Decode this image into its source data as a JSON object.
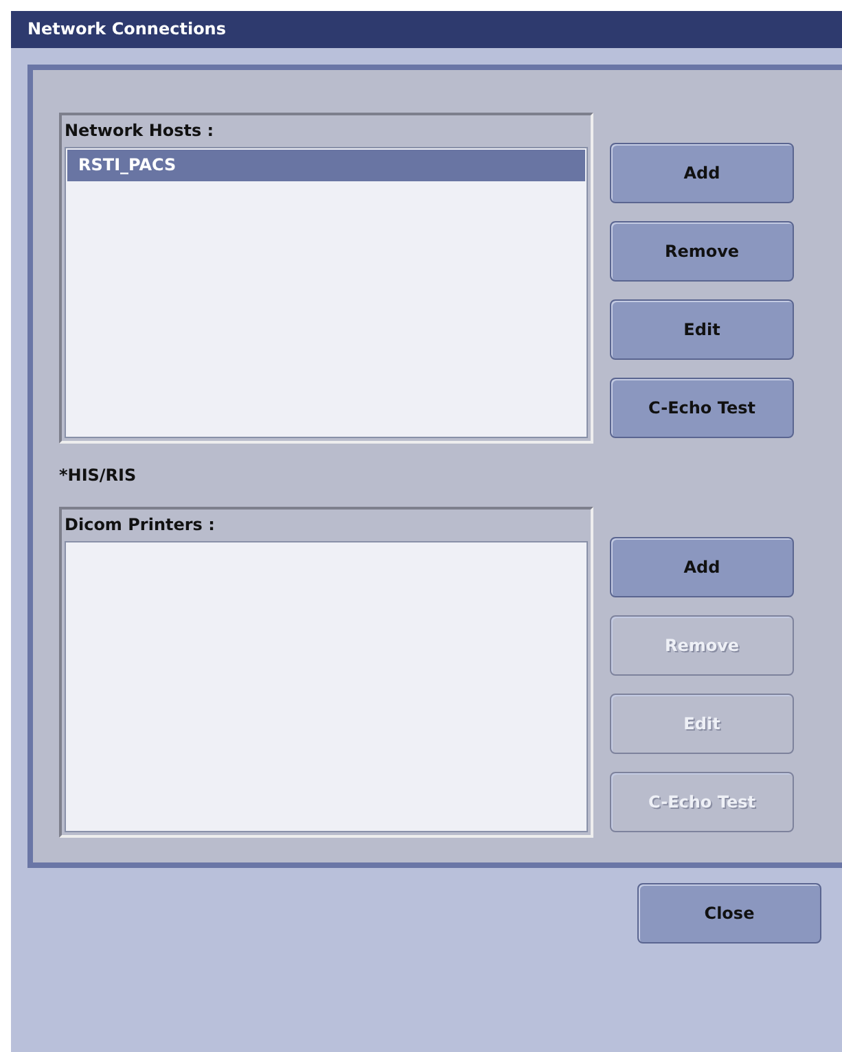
{
  "window": {
    "title": "Network Connections"
  },
  "sections": [
    {
      "list_title": "Network Hosts :",
      "items": [
        {
          "label": "RSTI_PACS",
          "selected": true
        }
      ],
      "buttons": [
        {
          "label": "Add",
          "disabled": false
        },
        {
          "label": "Remove",
          "disabled": false
        },
        {
          "label": "Edit",
          "disabled": false
        },
        {
          "label": "C-Echo Test",
          "disabled": false
        }
      ]
    },
    {
      "note": "*HIS/RIS",
      "list_title": "Dicom Printers :",
      "buttons": [
        {
          "label": "Add",
          "disabled": false
        },
        {
          "label": "Remove",
          "disabled": true
        },
        {
          "label": "Edit",
          "disabled": true
        },
        {
          "label": "C-Echo Test",
          "disabled": true
        }
      ]
    }
  ],
  "footer_buttons": [
    {
      "label": "Close",
      "disabled": false
    }
  ]
}
